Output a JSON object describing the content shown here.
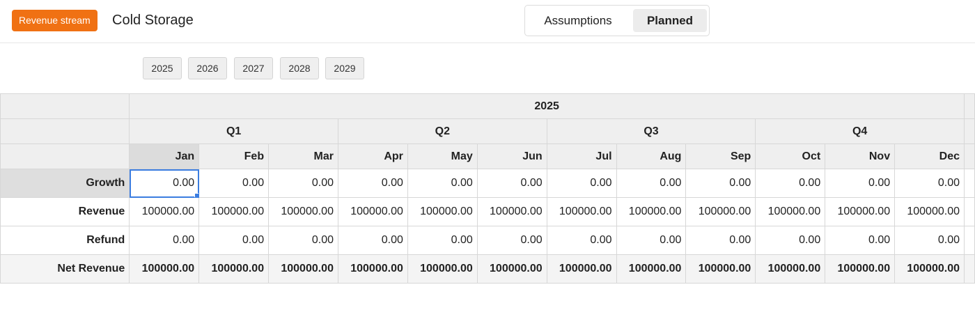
{
  "header": {
    "badge_label": "Revenue stream",
    "stream_name": "Cold Storage",
    "tabs": [
      {
        "label": "Assumptions",
        "active": false
      },
      {
        "label": "Planned",
        "active": true
      }
    ],
    "accent_color": "#f07113"
  },
  "years": [
    "2025",
    "2026",
    "2027",
    "2028",
    "2029"
  ],
  "grid": {
    "year": "2025",
    "quarters": [
      "Q1",
      "Q2",
      "Q3",
      "Q4"
    ],
    "months": [
      "Jan",
      "Feb",
      "Mar",
      "Apr",
      "May",
      "Jun",
      "Jul",
      "Aug",
      "Sep",
      "Oct",
      "Nov",
      "Dec"
    ],
    "rows": [
      {
        "label": "Growth",
        "values": [
          "0.00",
          "0.00",
          "0.00",
          "0.00",
          "0.00",
          "0.00",
          "0.00",
          "0.00",
          "0.00",
          "0.00",
          "0.00",
          "0.00"
        ]
      },
      {
        "label": "Revenue",
        "values": [
          "100000.00",
          "100000.00",
          "100000.00",
          "100000.00",
          "100000.00",
          "100000.00",
          "100000.00",
          "100000.00",
          "100000.00",
          "100000.00",
          "100000.00",
          "100000.00"
        ]
      },
      {
        "label": "Refund",
        "values": [
          "0.00",
          "0.00",
          "0.00",
          "0.00",
          "0.00",
          "0.00",
          "0.00",
          "0.00",
          "0.00",
          "0.00",
          "0.00",
          "0.00"
        ]
      },
      {
        "label": "Net Revenue",
        "values": [
          "100000.00",
          "100000.00",
          "100000.00",
          "100000.00",
          "100000.00",
          "100000.00",
          "100000.00",
          "100000.00",
          "100000.00",
          "100000.00",
          "100000.00",
          "100000.00"
        ]
      }
    ]
  }
}
